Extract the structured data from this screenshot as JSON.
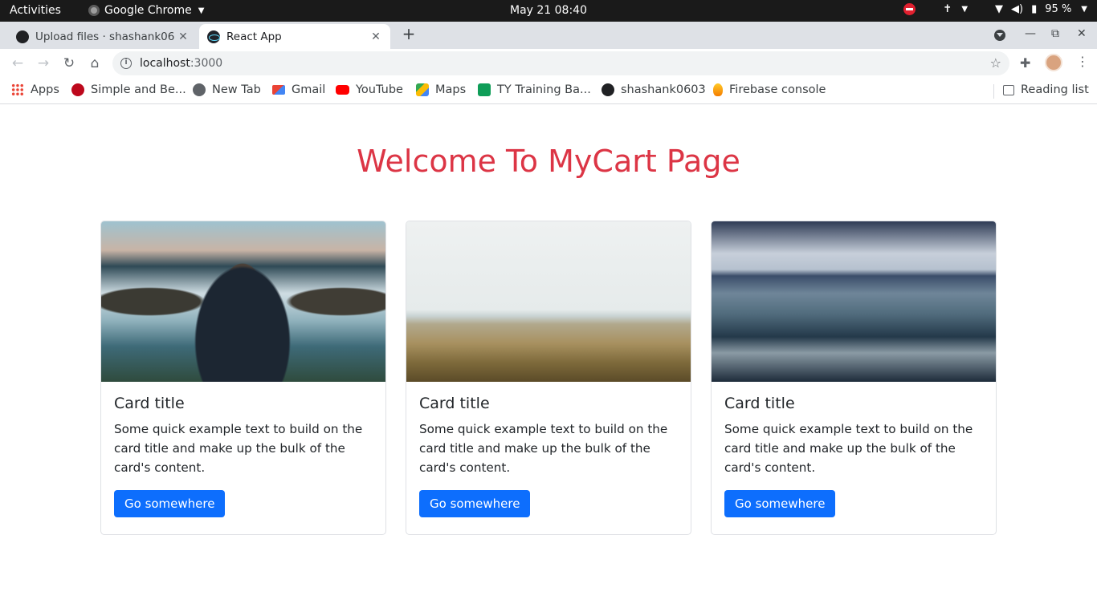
{
  "topbar": {
    "activities": "Activities",
    "app_name": "Google Chrome",
    "clock": "May 21  08:40",
    "battery": "95 %"
  },
  "tabs": [
    {
      "title": "Upload files · shashank06",
      "favicon": "github-icon",
      "active": false
    },
    {
      "title": "React App",
      "favicon": "react-icon",
      "active": true
    }
  ],
  "omnibox": {
    "host": "localhost",
    "port": ":3000"
  },
  "bookmarks": [
    {
      "label": "Apps",
      "icon": "apps-grid-icon"
    },
    {
      "label": "Simple and Be...",
      "icon": "pinterest-icon"
    },
    {
      "label": "New Tab",
      "icon": "globe-icon"
    },
    {
      "label": "Gmail",
      "icon": "gmail-icon"
    },
    {
      "label": "YouTube",
      "icon": "youtube-icon"
    },
    {
      "label": "Maps",
      "icon": "maps-icon"
    },
    {
      "label": "TY Training Ba...",
      "icon": "sheets-icon"
    },
    {
      "label": "shashank0603",
      "icon": "github-icon"
    },
    {
      "label": "Firebase console",
      "icon": "firebase-icon"
    }
  ],
  "reading_list": "Reading list",
  "page": {
    "heading": "Welcome To MyCart Page",
    "heading_color": "#dc3545",
    "button_color": "#0d6efd",
    "cards": [
      {
        "title": "Card title",
        "text": "Some quick example text to build on the card title and make up the bulk of the card's content.",
        "button": "Go somewhere",
        "image": "man-by-lake-photo"
      },
      {
        "title": "Card title",
        "text": "Some quick example text to build on the card title and make up the bulk of the card's content.",
        "button": "Go somewhere",
        "image": "beach-grass-photo"
      },
      {
        "title": "Card title",
        "text": "Some quick example text to build on the card title and make up the bulk of the card's content.",
        "button": "Go somewhere",
        "image": "ocean-waves-photo"
      }
    ]
  }
}
